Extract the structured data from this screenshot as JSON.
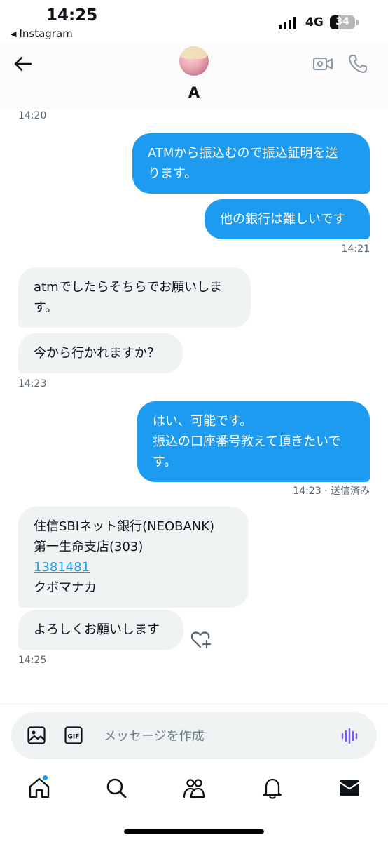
{
  "status_bar": {
    "time": "14:25",
    "back_app": "Instagram",
    "network": "4G",
    "battery": "34",
    "battery_level": 0.34
  },
  "header": {
    "back_icon": "arrow-left-icon",
    "contact_name": "A",
    "video_icon": "video-call-icon",
    "phone_icon": "phone-icon"
  },
  "messages": [
    {
      "type": "timestamp",
      "text": "14:20"
    },
    {
      "type": "sent",
      "lines": [
        "ATMから振込むので振込証明を送",
        "ります。"
      ]
    },
    {
      "type": "sent",
      "lines": [
        "他の銀行は難しいです"
      ]
    },
    {
      "type": "timestamp",
      "text": "14:21"
    },
    {
      "type": "received",
      "lines": [
        "atmでしたらそちらでお願いしま",
        "す。"
      ]
    },
    {
      "type": "received",
      "lines": [
        "今から行かれますか？"
      ]
    },
    {
      "type": "timestamp",
      "text": "14:23"
    },
    {
      "type": "sent",
      "lines": [
        "はい、可能です。",
        "振込の口座番号教えて頂きたいで",
        "す。"
      ]
    },
    {
      "type": "timestamp",
      "text": "14:23 · 送信済み"
    },
    {
      "type": "received",
      "lines": [
        "住信SBIネット銀行(NEOBANK)",
        "第一生命支店(303)",
        "1381481",
        "クボマナカ"
      ]
    },
    {
      "type": "received",
      "lines": [
        "よろしくお願いします"
      ]
    },
    {
      "type": "timestamp",
      "text": "14:25"
    }
  ],
  "composer": {
    "placeholder": "メッセージを作成",
    "image_icon": "image-icon",
    "gif_icon": "gif-icon",
    "voice_icon": "voice-message-icon",
    "accent_color": "#7856ff"
  },
  "nav": [
    "home-icon",
    "search-icon",
    "communities-icon",
    "notifications-icon",
    "messages-icon"
  ],
  "colors": {
    "sent_bubble": "#1d9bf0",
    "received_bubble": "#eff3f4",
    "link": "#1d9bf0"
  }
}
